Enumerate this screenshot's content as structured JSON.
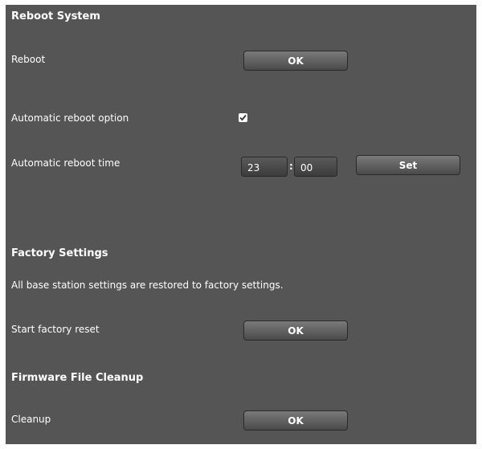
{
  "reboot": {
    "heading": "Reboot System",
    "reboot_label": "Reboot",
    "reboot_button": "OK",
    "auto_option_label": "Automatic reboot option",
    "auto_option_checked": true,
    "auto_time_label": "Automatic reboot time",
    "hours": "23",
    "separator": ":",
    "minutes": "00",
    "set_button": "Set"
  },
  "factory": {
    "heading": "Factory Settings",
    "description": "All base station settings are restored to factory settings.",
    "reset_label": "Start factory reset",
    "reset_button": "OK"
  },
  "firmware": {
    "heading": "Firmware File Cleanup",
    "cleanup_label": "Cleanup",
    "cleanup_button": "OK"
  },
  "colors": {
    "panel_bg": "#555555",
    "text": "#ffffff"
  }
}
